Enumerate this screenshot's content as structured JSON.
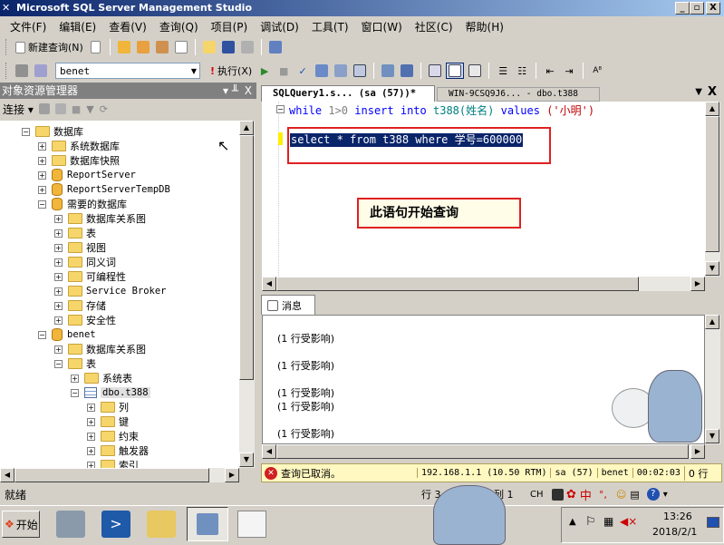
{
  "window": {
    "title": "Microsoft SQL Server Management Studio",
    "min": "_",
    "max": "▫",
    "close": "X"
  },
  "menu": [
    "文件(F)",
    "编辑(E)",
    "查看(V)",
    "查询(Q)",
    "项目(P)",
    "调试(D)",
    "工具(T)",
    "窗口(W)",
    "社区(C)",
    "帮助(H)"
  ],
  "toolbar1": {
    "new_query": "新建查询(N)"
  },
  "toolbar2": {
    "database": "benet",
    "execute": "执行(X)"
  },
  "explorer": {
    "title": "对象资源管理器",
    "pin": "▾ ╨",
    "close": "X",
    "connect": "连接",
    "nodes": [
      {
        "label": "数据库",
        "exp": "−",
        "icon": "folder"
      },
      {
        "label": "系统数据库",
        "exp": "+",
        "icon": "folder"
      },
      {
        "label": "数据库快照",
        "exp": "+",
        "icon": "folder"
      },
      {
        "label": "ReportServer",
        "exp": "+",
        "icon": "db"
      },
      {
        "label": "ReportServerTempDB",
        "exp": "+",
        "icon": "db"
      },
      {
        "label": "需要的数据库",
        "exp": "−",
        "icon": "db"
      },
      {
        "label": "数据库关系图",
        "exp": "+",
        "icon": "folder"
      },
      {
        "label": "表",
        "exp": "+",
        "icon": "folder"
      },
      {
        "label": "视图",
        "exp": "+",
        "icon": "folder"
      },
      {
        "label": "同义词",
        "exp": "+",
        "icon": "folder"
      },
      {
        "label": "可编程性",
        "exp": "+",
        "icon": "folder"
      },
      {
        "label": "Service Broker",
        "exp": "+",
        "icon": "folder"
      },
      {
        "label": "存储",
        "exp": "+",
        "icon": "folder"
      },
      {
        "label": "安全性",
        "exp": "+",
        "icon": "folder"
      },
      {
        "label": "benet",
        "exp": "−",
        "icon": "db"
      },
      {
        "label": "数据库关系图",
        "exp": "+",
        "icon": "folder"
      },
      {
        "label": "表",
        "exp": "−",
        "icon": "folder"
      },
      {
        "label": "系统表",
        "exp": "+",
        "icon": "folder"
      },
      {
        "label": "dbo.t388",
        "exp": "−",
        "icon": "table"
      },
      {
        "label": "列",
        "exp": "+",
        "icon": "folder"
      },
      {
        "label": "键",
        "exp": "+",
        "icon": "folder"
      },
      {
        "label": "约束",
        "exp": "+",
        "icon": "folder"
      },
      {
        "label": "触发器",
        "exp": "+",
        "icon": "folder"
      },
      {
        "label": "索引",
        "exp": "+",
        "icon": "folder"
      }
    ]
  },
  "tabs": {
    "active": "SQLQuery1.s... (sa (57))*",
    "inactive": "WIN-9CSQ9J6... - dbo.t388"
  },
  "sql": {
    "line1_kw1": "while",
    "line1_num": "1>0",
    "line1_kw2": "insert into",
    "line1_tbl": "t388(姓名)",
    "line1_kw3": "values",
    "line1_str": "('小明')",
    "line2": "select * from t388 where 学号=600000"
  },
  "callout": "此语句开始查询",
  "messages": {
    "tab": "消息",
    "lines": [
      "(1 行受影响)",
      "(1 行受影响)",
      "(1 行受影响)",
      "(1 行受影响)",
      "(1 行受影响)"
    ]
  },
  "status": {
    "cancel": "查询已取消。",
    "server": "192.168.1.1 (10.50 RTM)",
    "user": "sa (57)",
    "db": "benet",
    "time": "00:02:03",
    "rows": "0 行"
  },
  "appstatus": {
    "ready": "就绪",
    "row": "行 3",
    "col": "列 1",
    "ch": "CH",
    "ime": "中"
  },
  "taskbar": {
    "start": "开始",
    "time": "13:26",
    "date": "2018/2/1"
  }
}
